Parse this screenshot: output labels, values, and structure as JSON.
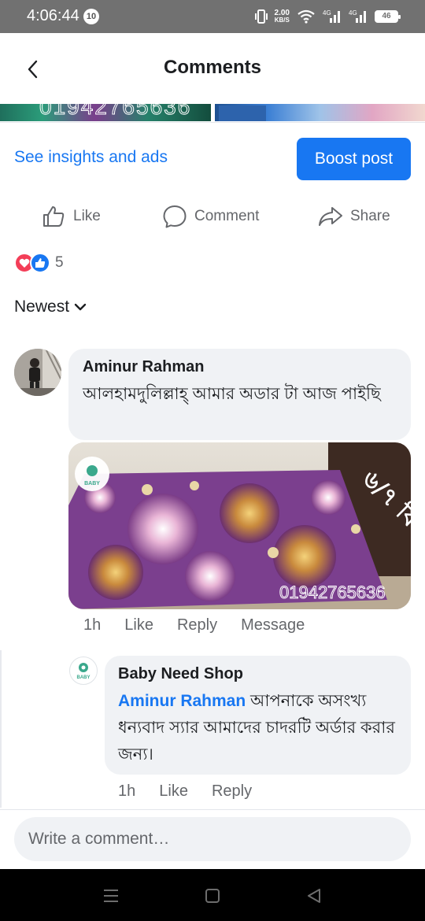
{
  "status_bar": {
    "time": "4:06:44",
    "notification_count": "10",
    "speed_value": "2.00",
    "speed_unit": "KB/S",
    "net1": "4G",
    "net2": "4G",
    "battery": "46"
  },
  "header": {
    "title": "Comments",
    "back_icon": "chevron-left-icon"
  },
  "post_strip": {
    "phone_watermark": "01942765636"
  },
  "insights": {
    "link_label": "See insights and ads",
    "boost_label": "Boost post"
  },
  "actions": {
    "like": "Like",
    "comment": "Comment",
    "share": "Share"
  },
  "reactions": {
    "count": "5",
    "icons": [
      "love-icon",
      "like-icon"
    ]
  },
  "sort": {
    "label": "Newest",
    "icon": "chevron-down-icon"
  },
  "comments": [
    {
      "author": "Aminur Rahman",
      "text": "আলহামদুলিল্লাহ্ আমার অডার টা আজ পাইছি",
      "photo": {
        "badge": "BABY",
        "overlay_text": "৬/৭ ফিট",
        "phone": "01942765636"
      },
      "time": "1h",
      "like_label": "Like",
      "reply_label": "Reply",
      "message_label": "Message"
    }
  ],
  "reply": {
    "author": "Baby Need Shop",
    "mention": "Aminur Rahman",
    "text": " আপনাকে অসংখ্য ধন্যবাদ স্যার আমাদের চাদরটি অর্ডার করার জন্য।",
    "avatar_badge": "BABY",
    "time": "1h",
    "like_label": "Like",
    "reply_label": "Reply"
  },
  "composer": {
    "placeholder": "Write a comment…"
  },
  "colors": {
    "accent": "#1877f2",
    "bubble": "#f0f2f5",
    "muted_text": "#65676b",
    "love": "#f33e58"
  }
}
